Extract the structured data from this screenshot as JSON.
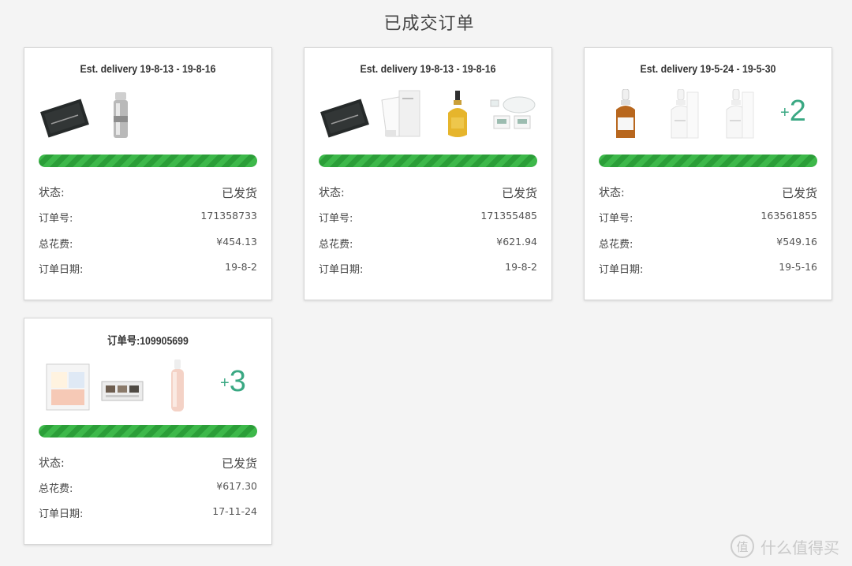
{
  "page_title": "已成交订单",
  "labels": {
    "status": "状态:",
    "order_no": "订单号:",
    "total": "总花费:",
    "order_date": "订单日期:"
  },
  "orders": [
    {
      "heading": "Est. delivery 19-8-13 - 19-8-16",
      "products": [
        "black-sachet",
        "silver-serum-bottle"
      ],
      "progress_fraction": 1.0,
      "status": "已发货",
      "order_no": "171358733",
      "total": "¥454.13",
      "order_date": "19-8-2"
    },
    {
      "heading": "Est. delivery 19-8-13 - 19-8-16",
      "products": [
        "black-sachet",
        "white-tube",
        "yellow-oil-dropper",
        "eye-mask-set"
      ],
      "progress_fraction": 1.0,
      "status": "已发货",
      "order_no": "171355485",
      "total": "¥621.94",
      "order_date": "19-8-2"
    },
    {
      "heading": "Est. delivery 19-5-24 - 19-5-30",
      "products": [
        "amber-dropper-bottle",
        "white-dropper-bottle",
        "white-dropper-bottle"
      ],
      "more": "2",
      "progress_fraction": 1.0,
      "status": "已发货",
      "order_no": "163561855",
      "total": "¥549.16",
      "order_date": "19-5-16"
    },
    {
      "heading": "订单号:109905699",
      "products": [
        "powder-palette",
        "eyeshadow-palette",
        "pink-lotion-bottle"
      ],
      "more": "3",
      "progress_fraction": 1.0,
      "status": "已发货",
      "total": "¥617.30",
      "order_date": "17-11-24"
    }
  ],
  "watermark": {
    "glyph": "值",
    "text": "什么值得买"
  },
  "colors": {
    "progress": "#3db84a",
    "more_count": "#3aa883"
  }
}
